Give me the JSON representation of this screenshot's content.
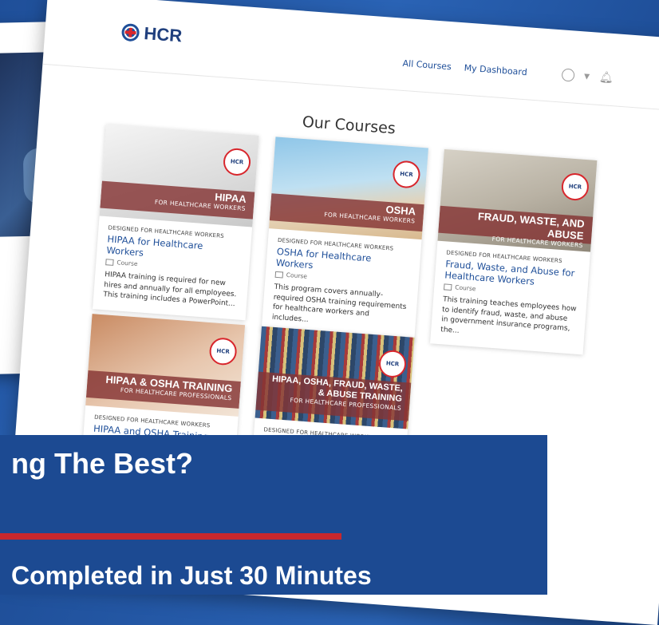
{
  "brand": {
    "name": "HCR",
    "badge_text": "HCR"
  },
  "nav": {
    "all_courses": "All Courses",
    "my_dashboard": "My Dashboard"
  },
  "page": {
    "heading": "Our Courses"
  },
  "courses": [
    {
      "band_title": "HIPAA",
      "band_sub": "FOR HEALTHCARE WORKERS",
      "category": "DESIGNED FOR HEALTHCARE WORKERS",
      "title": "HIPAA for Healthcare Workers",
      "type": "Course",
      "description": "HIPAA training is required for new hires and annually for all employees. This training includes a PowerPoint..."
    },
    {
      "band_title": "OSHA",
      "band_sub": "FOR HEALTHCARE WORKERS",
      "category": "DESIGNED FOR HEALTHCARE WORKERS",
      "title": "OSHA for Healthcare Workers",
      "type": "Course",
      "description": "This program covers annually-required OSHA training requirements for healthcare workers and includes..."
    },
    {
      "band_title": "FRAUD, WASTE, AND ABUSE",
      "band_sub": "FOR HEALTHCARE WORKERS",
      "category": "DESIGNED FOR HEALTHCARE WORKERS",
      "title": "Fraud, Waste, and Abuse for Healthcare Workers",
      "type": "Course",
      "description": "This training teaches employees how to identify fraud, waste, and abuse in government insurance programs, the..."
    },
    {
      "band_title": "HIPAA & OSHA TRAINING",
      "band_sub": "FOR HEALTHCARE PROFESSIONALS",
      "category": "DESIGNED FOR HEALTHCARE WORKERS",
      "title": "HIPAA and OSHA Training"
    },
    {
      "band_title": "HIPAA, OSHA, FRAUD, WASTE, & ABUSE TRAINING",
      "band_sub": "FOR HEALTHCARE PROFESSIONALS",
      "category": "DESIGNED FOR HEALTHCARE WORKERS"
    }
  ],
  "banner": {
    "headline": "ng The Best?",
    "subline": "Completed in Just 30 Minutes"
  },
  "colors": {
    "brand_blue": "#1f4f99",
    "accent_red": "#c8282d",
    "band": "#853434"
  }
}
